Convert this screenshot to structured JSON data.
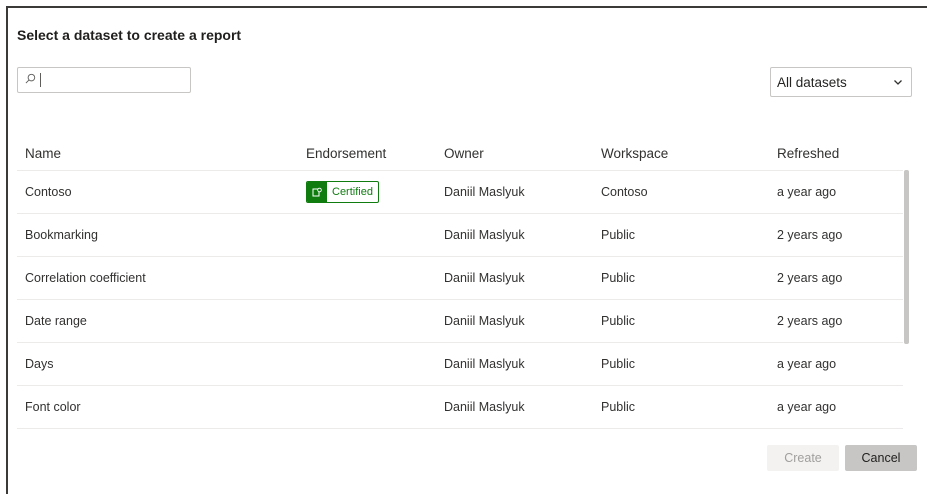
{
  "dialog": {
    "title": "Select a dataset to create a report"
  },
  "search": {
    "value": "",
    "placeholder": ""
  },
  "filter": {
    "selected": "All datasets"
  },
  "table": {
    "headers": {
      "name": "Name",
      "endorsement": "Endorsement",
      "owner": "Owner",
      "workspace": "Workspace",
      "refreshed": "Refreshed"
    },
    "rows": [
      {
        "name": "Contoso",
        "endorsement": "Certified",
        "owner": "Daniil Maslyuk",
        "workspace": "Contoso",
        "refreshed": "a year ago"
      },
      {
        "name": "Bookmarking",
        "endorsement": "",
        "owner": "Daniil Maslyuk",
        "workspace": "Public",
        "refreshed": "2 years ago"
      },
      {
        "name": "Correlation coefficient",
        "endorsement": "",
        "owner": "Daniil Maslyuk",
        "workspace": "Public",
        "refreshed": "2 years ago"
      },
      {
        "name": "Date range",
        "endorsement": "",
        "owner": "Daniil Maslyuk",
        "workspace": "Public",
        "refreshed": "2 years ago"
      },
      {
        "name": "Days",
        "endorsement": "",
        "owner": "Daniil Maslyuk",
        "workspace": "Public",
        "refreshed": "a year ago"
      },
      {
        "name": "Font color",
        "endorsement": "",
        "owner": "Daniil Maslyuk",
        "workspace": "Public",
        "refreshed": "a year ago"
      }
    ]
  },
  "buttons": {
    "create": "Create",
    "cancel": "Cancel"
  },
  "colors": {
    "certified": "#107c10",
    "border": "#c8c6c4"
  },
  "icons": {
    "search": "search-icon",
    "dropdown": "chevron-down-icon",
    "certified": "certified-dataset-icon"
  }
}
